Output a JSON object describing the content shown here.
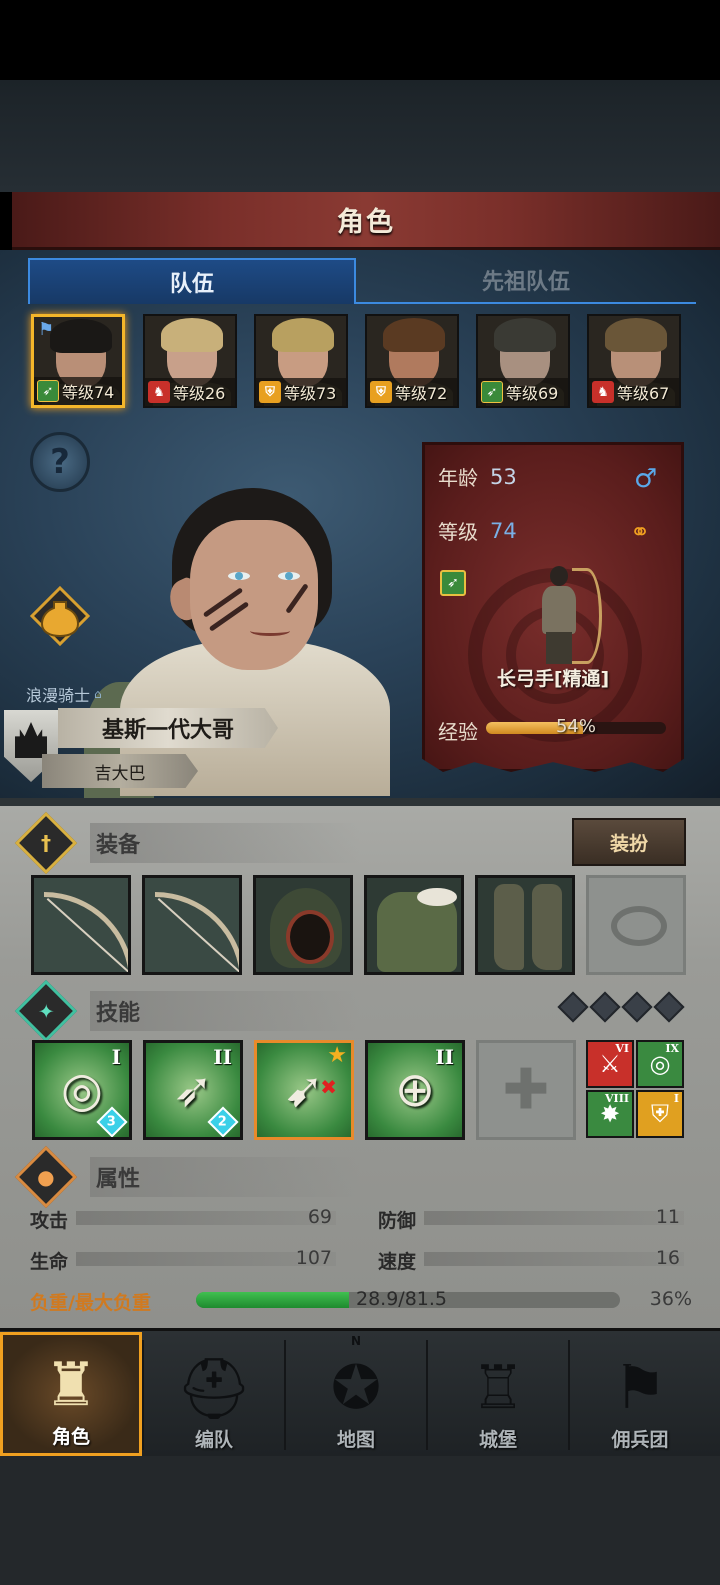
{
  "title": "角色",
  "tabs": [
    {
      "label": "队伍",
      "active": true
    },
    {
      "label": "先祖队伍",
      "active": false
    }
  ],
  "roster": [
    {
      "level_text": "等级74",
      "class_icon": "bow-icon",
      "selected": true,
      "flag": true,
      "hair": "#1a1816",
      "skin": "#b98f77"
    },
    {
      "level_text": "等级26",
      "class_icon": "horse-icon",
      "selected": false,
      "hair": "#c8b07a",
      "skin": "#c8a08a"
    },
    {
      "level_text": "等级73",
      "class_icon": "shield-icon",
      "selected": false,
      "hair": "#b8a060",
      "skin": "#c89c82"
    },
    {
      "level_text": "等级72",
      "class_icon": "shield-icon",
      "selected": false,
      "hair": "#5a3a22",
      "skin": "#b07a5e"
    },
    {
      "level_text": "等级69",
      "class_icon": "bow-icon",
      "selected": false,
      "hair": "#3a3a34",
      "skin": "#a89080"
    },
    {
      "level_text": "等级67",
      "class_icon": "horse-icon",
      "selected": false,
      "hair": "#6a5638",
      "skin": "#b89078"
    }
  ],
  "hero": {
    "class_title": "浪漫骑士",
    "name": "基斯一代大哥",
    "subtitle": "吉大巴"
  },
  "info": {
    "age_label": "年龄",
    "age": "53",
    "level_label": "等级",
    "level": "74",
    "class_name": "长弓手[精通]",
    "exp_label": "经验",
    "exp_percent_text": "54%",
    "exp_fraction": 0.54
  },
  "equipment": {
    "section_title": "装备",
    "dress_button": "装扮",
    "slots": [
      "bow-item",
      "bow-item",
      "hood-item",
      "armor-item",
      "boots-item",
      "ring-slot-empty"
    ]
  },
  "skills": {
    "section_title": "技能",
    "slots": [
      {
        "icon": "target-arrow-icon",
        "rank": "I",
        "level": "3",
        "glyph": "◎"
      },
      {
        "icon": "arrows-icon",
        "rank": "II",
        "level": "2",
        "glyph": "➶"
      },
      {
        "icon": "bow-shot-icon",
        "rank": "",
        "level": "",
        "glyph": "➹",
        "selected": true,
        "star": true
      },
      {
        "icon": "crosshair-icon",
        "rank": "II",
        "level": "",
        "glyph": "⊕"
      }
    ],
    "passives": [
      {
        "icon": "sword-icon",
        "rank": "VI",
        "color": "#c8302a",
        "glyph": "⚔"
      },
      {
        "icon": "target-icon",
        "rank": "IX",
        "color": "#3a8a40",
        "glyph": "◎"
      },
      {
        "icon": "burst-icon",
        "rank": "VIII",
        "color": "#3a8a40",
        "glyph": "✸"
      },
      {
        "icon": "shield-icon",
        "rank": "I",
        "color": "#e0a020",
        "glyph": "⛨"
      }
    ]
  },
  "attributes": {
    "section_title": "属性",
    "attack_label": "攻击",
    "attack": "69",
    "defense_label": "防御",
    "defense": "11",
    "hp_label": "生命",
    "hp": "107",
    "speed_label": "速度",
    "speed": "16",
    "weight_label": "负重/最大负重",
    "weight_text": "28.9/81.5",
    "weight_percent_text": "36%",
    "weight_fraction": 0.36
  },
  "nav": [
    {
      "label": "角色",
      "icon": "knight-icon",
      "active": true
    },
    {
      "label": "编队",
      "icon": "helmet-icon",
      "active": false
    },
    {
      "label": "地图",
      "icon": "compass-icon",
      "active": false
    },
    {
      "label": "城堡",
      "icon": "castle-icon",
      "active": false
    },
    {
      "label": "佣兵团",
      "icon": "banner-icon",
      "active": false
    }
  ],
  "compass_label": "N"
}
